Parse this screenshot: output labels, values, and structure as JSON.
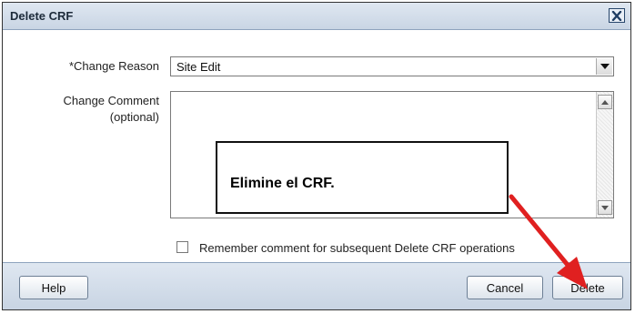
{
  "dialog": {
    "title": "Delete CRF",
    "close_icon": "close-icon"
  },
  "form": {
    "change_reason_label": "*Change Reason",
    "change_reason_value": "Site Edit",
    "change_comment_label_line1": "Change Comment",
    "change_comment_label_line2": "(optional)",
    "change_comment_value": "",
    "remember_label": "Remember comment for subsequent Delete CRF operations",
    "remember_checked": false
  },
  "callout": {
    "text": "Elimine el CRF."
  },
  "buttons": {
    "help": "Help",
    "cancel": "Cancel",
    "delete": "Delete"
  },
  "colors": {
    "annotation_arrow": "#e02020",
    "header_bg": "#d4deea"
  }
}
